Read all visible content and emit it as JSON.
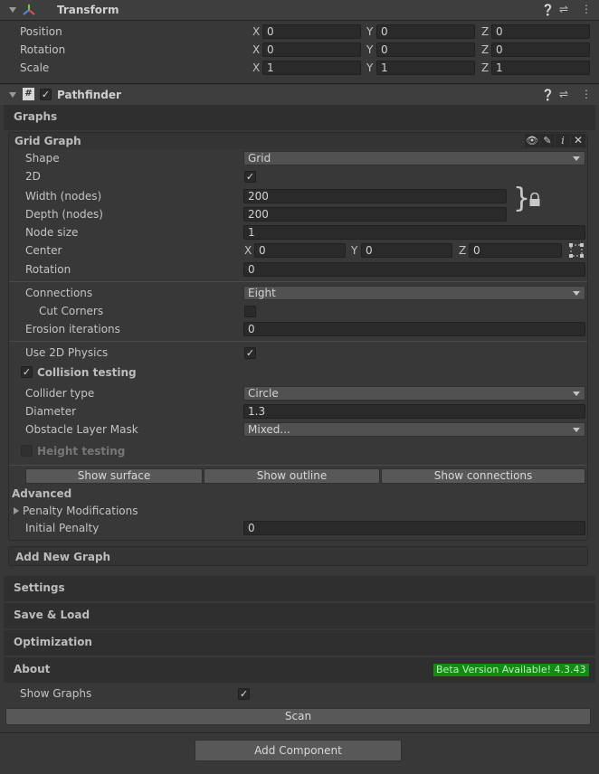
{
  "transform": {
    "title": "Transform",
    "rows": [
      {
        "label": "Position",
        "x": "0",
        "y": "0",
        "z": "0"
      },
      {
        "label": "Rotation",
        "x": "0",
        "y": "0",
        "z": "0"
      },
      {
        "label": "Scale",
        "x": "1",
        "y": "1",
        "z": "1"
      }
    ],
    "axis": {
      "x": "X",
      "y": "Y",
      "z": "Z"
    }
  },
  "pathfinder": {
    "title": "Pathfinder",
    "enabled": true,
    "graphs_tab": "Graphs",
    "grid_graph": {
      "title": "Grid Graph",
      "shape": {
        "label": "Shape",
        "value": "Grid"
      },
      "two_d": {
        "label": "2D",
        "checked": true
      },
      "width": {
        "label": "Width (nodes)",
        "value": "200"
      },
      "depth": {
        "label": "Depth (nodes)",
        "value": "200"
      },
      "bracket": "}",
      "node_size": {
        "label": "Node size",
        "value": "1"
      },
      "center": {
        "label": "Center",
        "x": "0",
        "y": "0",
        "z": "0"
      },
      "rotation": {
        "label": "Rotation",
        "value": "0"
      },
      "connections": {
        "label": "Connections",
        "value": "Eight"
      },
      "cut_corners": {
        "label": "Cut Corners",
        "checked": false
      },
      "erosion": {
        "label": "Erosion iterations",
        "value": "0"
      },
      "use_2d_physics": {
        "label": "Use 2D Physics",
        "checked": true
      },
      "collision_testing": {
        "label": "Collision testing",
        "checked": true
      },
      "collider_type": {
        "label": "Collider type",
        "value": "Circle"
      },
      "diameter": {
        "label": "Diameter",
        "value": "1.3"
      },
      "obstacle_mask": {
        "label": "Obstacle Layer Mask",
        "value": "Mixed..."
      },
      "height_testing": {
        "label": "Height testing",
        "checked": false
      },
      "buttons": {
        "surface": "Show surface",
        "outline": "Show outline",
        "connections": "Show connections"
      },
      "advanced": "Advanced",
      "penalty_mods": "Penalty Modifications",
      "initial_penalty": {
        "label": "Initial Penalty",
        "value": "0"
      }
    },
    "add_new_graph": "Add New Graph",
    "sections": [
      "Settings",
      "Save & Load",
      "Optimization",
      "About"
    ],
    "beta_badge": "Beta Version Available! 4.3.43",
    "show_graphs": {
      "label": "Show Graphs",
      "checked": true
    },
    "scan": "Scan"
  },
  "add_component": "Add Component",
  "colors": {
    "panel": "#383838",
    "header": "#3e3e3e",
    "section": "#2f2f2f",
    "field": "#2a2a2a",
    "badge": "#138a13"
  }
}
